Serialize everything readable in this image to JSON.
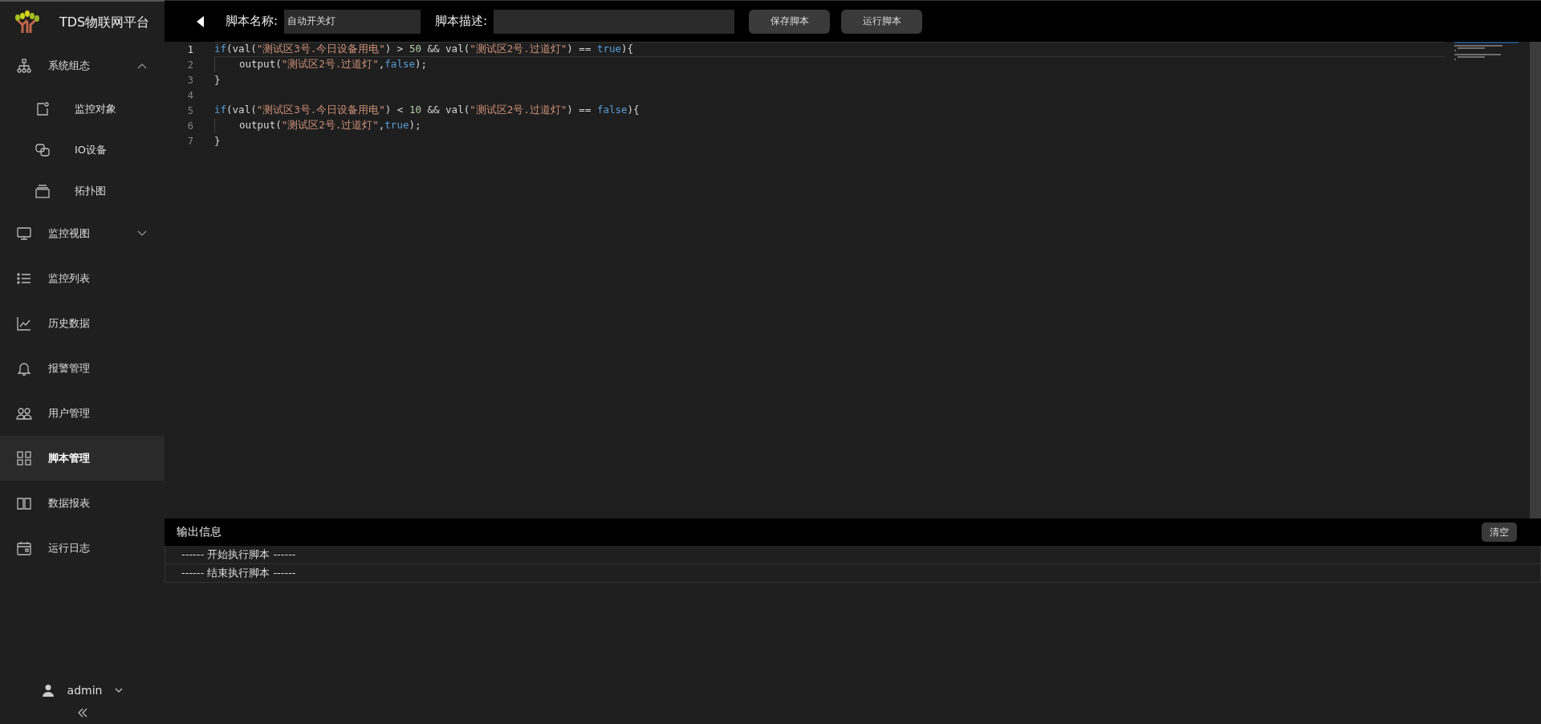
{
  "sidebar": {
    "logo_text": "TDS物联网平台",
    "menu": [
      {
        "label": "系统组态",
        "selected": false,
        "expanded": true,
        "children": [
          {
            "label": "监控对象",
            "selected": false
          },
          {
            "label": "IO设备",
            "selected": false
          },
          {
            "label": "拓扑图",
            "selected": false
          }
        ]
      },
      {
        "label": "监控视图",
        "selected": false,
        "expanded": false
      },
      {
        "label": "监控列表",
        "selected": false
      },
      {
        "label": "历史数据",
        "selected": false
      },
      {
        "label": "报警管理",
        "selected": false
      },
      {
        "label": "用户管理",
        "selected": false
      },
      {
        "label": "脚本管理",
        "selected": true
      },
      {
        "label": "数据报表",
        "selected": false
      },
      {
        "label": "运行日志",
        "selected": false
      }
    ],
    "user": "admin"
  },
  "toolbar": {
    "name_label": "脚本名称:",
    "name_value": "自动开关灯",
    "desc_label": "脚本描述:",
    "buttons": [
      "保存脚本",
      "运行脚本"
    ]
  },
  "editor": {
    "lines": [
      {
        "number": "1",
        "current": true,
        "indented": false,
        "tokens": [
          {
            "kind": "kw",
            "text": "if"
          },
          {
            "kind": "plain",
            "text": "(val("
          },
          {
            "kind": "str",
            "text": "\"测试区3号.今日设备用电\""
          },
          {
            "kind": "plain",
            "text": ") > "
          },
          {
            "kind": "num",
            "text": "50"
          },
          {
            "kind": "plain",
            "text": " && val("
          },
          {
            "kind": "str",
            "text": "\"测试区2号.过道灯\""
          },
          {
            "kind": "plain",
            "text": ") == "
          },
          {
            "kind": "kw",
            "text": "true"
          },
          {
            "kind": "plain",
            "text": "){"
          }
        ]
      },
      {
        "number": "2",
        "current": false,
        "indented": true,
        "tokens": [
          {
            "kind": "plain",
            "text": "output("
          },
          {
            "kind": "str",
            "text": "\"测试区2号.过道灯\""
          },
          {
            "kind": "plain",
            "text": ","
          },
          {
            "kind": "kw",
            "text": "false"
          },
          {
            "kind": "plain",
            "text": ");"
          }
        ]
      },
      {
        "number": "3",
        "current": false,
        "indented": false,
        "tokens": [
          {
            "kind": "plain",
            "text": "}"
          }
        ]
      },
      {
        "number": "4",
        "current": false,
        "indented": false
      },
      {
        "number": "5",
        "current": false,
        "indented": false,
        "tokens": [
          {
            "kind": "kw",
            "text": "if"
          },
          {
            "kind": "plain",
            "text": "(val("
          },
          {
            "kind": "str",
            "text": "\"测试区3号.今日设备用电\""
          },
          {
            "kind": "plain",
            "text": ") < "
          },
          {
            "kind": "num",
            "text": "10"
          },
          {
            "kind": "plain",
            "text": " && val("
          },
          {
            "kind": "str",
            "text": "\"测试区2号.过道灯\""
          },
          {
            "kind": "plain",
            "text": ") == "
          },
          {
            "kind": "kw",
            "text": "false"
          },
          {
            "kind": "plain",
            "text": "){"
          }
        ]
      },
      {
        "number": "6",
        "current": false,
        "indented": true,
        "tokens": [
          {
            "kind": "plain",
            "text": "output("
          },
          {
            "kind": "str",
            "text": "\"测试区2号.过道灯\""
          },
          {
            "kind": "plain",
            "text": ","
          },
          {
            "kind": "kw",
            "text": "true"
          },
          {
            "kind": "plain",
            "text": ");"
          }
        ]
      },
      {
        "number": "7",
        "current": false,
        "indented": false,
        "tokens": [
          {
            "kind": "plain",
            "text": "}"
          }
        ]
      }
    ]
  },
  "output": {
    "title": "输出信息",
    "clear_button": "清空",
    "rows": [
      "------ 开始执行脚本 ------",
      "------ 结束执行脚本 ------"
    ]
  }
}
